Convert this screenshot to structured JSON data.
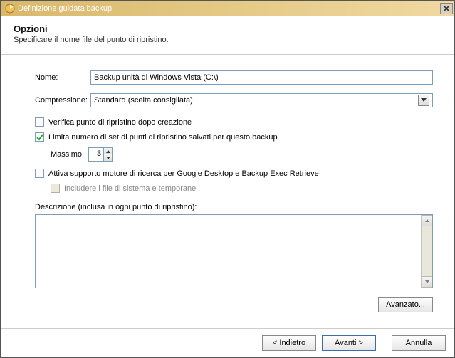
{
  "window": {
    "title": "Definizione guidata backup"
  },
  "header": {
    "title": "Opzioni",
    "subtitle": "Specificare il nome file del punto di ripristino."
  },
  "form": {
    "name_label": "Nome:",
    "name_value": "Backup unità di Windows Vista (C:\\)",
    "compression_label": "Compressione:",
    "compression_value": "Standard (scelta consigliata)"
  },
  "options": {
    "verify": {
      "label": "Verifica punto di ripristino dopo creazione",
      "checked": false
    },
    "limit": {
      "label": "Limita numero di set di punti di ripristino salvati per questo backup",
      "checked": true
    },
    "max_label": "Massimo:",
    "max_value": "3",
    "search_engine": {
      "label": "Attiva supporto motore di ricerca per Google Desktop e Backup Exec Retrieve",
      "checked": false
    },
    "include_system": {
      "label": "Includere i file di sistema e temporanei",
      "checked": false,
      "disabled": true
    }
  },
  "description": {
    "label": "Descrizione (inclusa in ogni punto di ripristino):",
    "value": ""
  },
  "buttons": {
    "advanced": "Avanzato...",
    "back": "< Indietro",
    "next": "Avanti >",
    "cancel": "Annulla"
  }
}
